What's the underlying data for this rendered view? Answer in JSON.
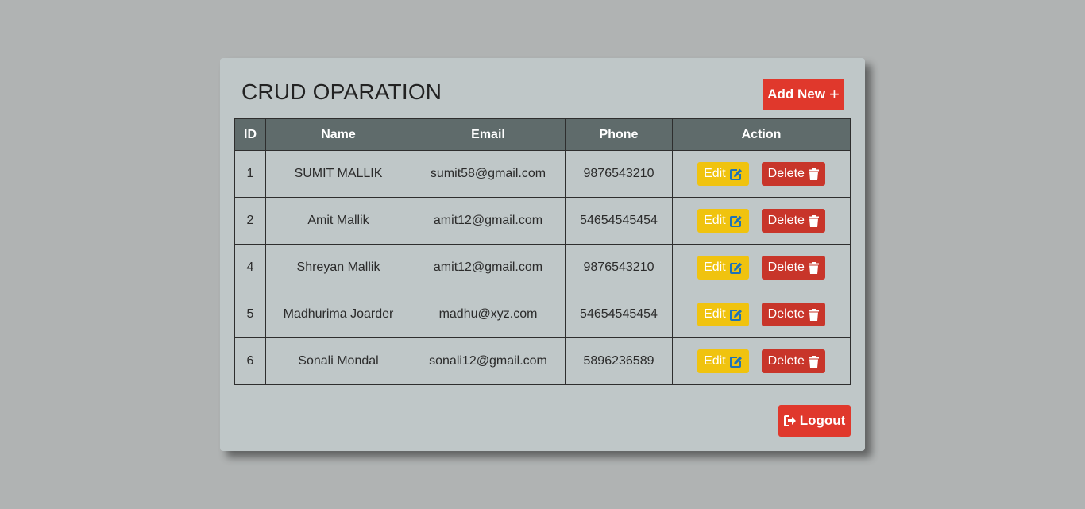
{
  "header": {
    "title": "CRUD OPARATION",
    "add_label": "Add New",
    "add_icon": "+"
  },
  "table": {
    "columns": [
      "ID",
      "Name",
      "Email",
      "Phone",
      "Action"
    ],
    "rows": [
      {
        "id": "1",
        "name": "SUMIT MALLIK",
        "email": "sumit58@gmail.com",
        "phone": "9876543210"
      },
      {
        "id": "2",
        "name": "Amit Mallik",
        "email": "amit12@gmail.com",
        "phone": "54654545454"
      },
      {
        "id": "4",
        "name": "Shreyan Mallik",
        "email": "amit12@gmail.com",
        "phone": "9876543210"
      },
      {
        "id": "5",
        "name": "Madhurima Joarder",
        "email": "madhu@xyz.com",
        "phone": "54654545454"
      },
      {
        "id": "6",
        "name": "Sonali Mondal",
        "email": "sonali12@gmail.com",
        "phone": "5896236589"
      }
    ],
    "edit_label": "Edit",
    "delete_label": "Delete"
  },
  "footer": {
    "logout_label": "Logout"
  },
  "colors": {
    "background": "#b0b3b3",
    "card": "#bfc7c8",
    "header_row": "#5f6b6b",
    "primary_red": "#e0382c",
    "edit_yellow": "#f0c30f",
    "delete_red": "#c8352a",
    "edit_icon_blue": "#1f73b7"
  },
  "icons": {
    "add": "plus-icon",
    "edit": "edit-icon",
    "delete": "trash-icon",
    "logout": "sign-out-icon"
  }
}
